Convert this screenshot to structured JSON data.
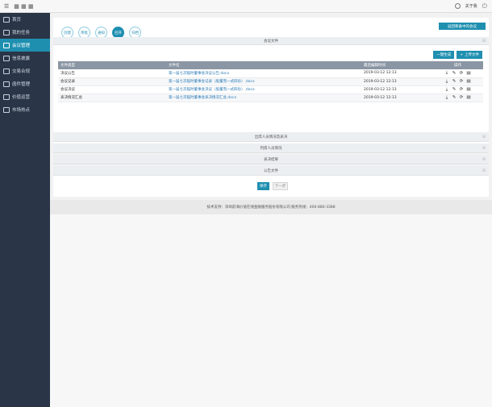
{
  "topbar": {
    "menu_icon": "menu-icon",
    "apps_icon": "grid-icon",
    "user_name": "关于我",
    "user_icon": "user-icon",
    "power_icon": "power-icon"
  },
  "sidebar": {
    "items": [
      {
        "label": "首页",
        "icon": "home-icon"
      },
      {
        "label": "我的任务",
        "icon": "task-icon"
      },
      {
        "label": "会议管理",
        "icon": "meeting-icon",
        "active": true
      },
      {
        "label": "信息披露",
        "icon": "disclosure-icon"
      },
      {
        "label": "交易合规",
        "icon": "compliance-icon"
      },
      {
        "label": "函件管理",
        "icon": "letter-icon"
      },
      {
        "label": "价值运营",
        "icon": "value-icon"
      },
      {
        "label": "市场热点",
        "icon": "hot-icon"
      }
    ]
  },
  "steps": {
    "items": [
      "创建",
      "审批",
      "通知",
      "召开",
      "归档"
    ],
    "active_index": 3,
    "back_label": "返回筹备中的会议"
  },
  "files_section": {
    "title": "会议文件",
    "batch_download": "一键生成",
    "upload": "上传文件",
    "columns": [
      "文件类型",
      "文件名",
      "最后编辑时间",
      "操作"
    ],
    "rows": [
      {
        "type": "决议公告",
        "name": "第一届七次临时董事会决议公告.docx",
        "time": "2019-03-12 12:13"
      },
      {
        "type": "会议记录",
        "name": "第一届七次临时董事会记录（股董而一式四份）.docx",
        "time": "2019-03-12 12:13"
      },
      {
        "type": "会议决议",
        "name": "第一届七次临时董事会决议（股董而一式四份）.docx",
        "time": "2019-03-12 12:13"
      },
      {
        "type": "表决情况汇总",
        "name": "第一届七次临时董事会表决情况汇总.docx",
        "time": "2019-03-12 12:13"
      }
    ]
  },
  "folds": [
    "出席人员情况及表决",
    "列席人员情况",
    "表决结果",
    "公告文件"
  ],
  "buttons": {
    "save": "保存",
    "next": "下一步"
  },
  "footer": "技术支持：深圳前海价值在线金融服务股份有限公司 服务热线：400-880-3388",
  "colors": {
    "accent": "#1f8fb0",
    "sidebar": "#2a3547"
  }
}
